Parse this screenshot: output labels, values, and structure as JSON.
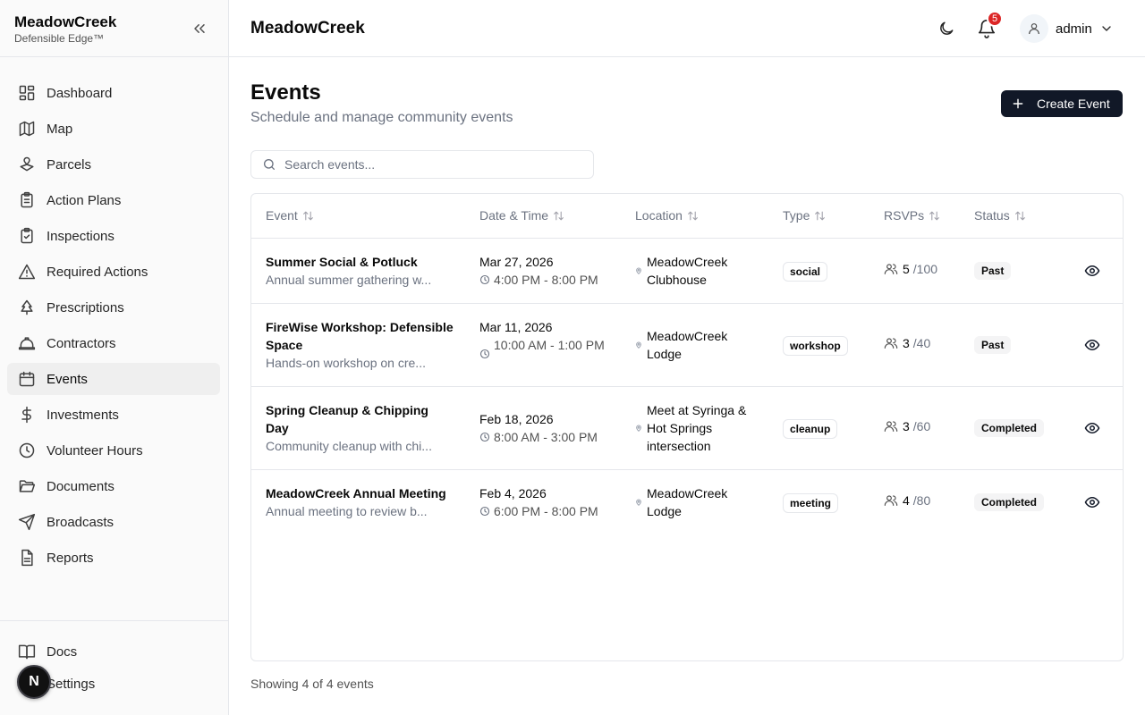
{
  "sidebar": {
    "brand": "MeadowCreek",
    "tagline": "Defensible Edge™",
    "items": [
      {
        "label": "Dashboard",
        "icon": "dashboard-icon"
      },
      {
        "label": "Map",
        "icon": "map-icon"
      },
      {
        "label": "Parcels",
        "icon": "parcels-icon"
      },
      {
        "label": "Action Plans",
        "icon": "clipboard-icon"
      },
      {
        "label": "Inspections",
        "icon": "clipboard-check-icon"
      },
      {
        "label": "Required Actions",
        "icon": "alert-triangle-icon"
      },
      {
        "label": "Prescriptions",
        "icon": "tree-icon"
      },
      {
        "label": "Contractors",
        "icon": "hard-hat-icon"
      },
      {
        "label": "Events",
        "icon": "calendar-icon",
        "active": true
      },
      {
        "label": "Investments",
        "icon": "dollar-icon"
      },
      {
        "label": "Volunteer Hours",
        "icon": "clock-icon"
      },
      {
        "label": "Documents",
        "icon": "folder-open-icon"
      },
      {
        "label": "Broadcasts",
        "icon": "send-icon"
      },
      {
        "label": "Reports",
        "icon": "file-text-icon"
      }
    ],
    "bottom_items": [
      {
        "label": "Docs",
        "icon": "book-icon"
      },
      {
        "label": "Settings",
        "icon": "gear-icon"
      }
    ],
    "floating_badge": "N"
  },
  "header": {
    "title": "MeadowCreek",
    "notification_count": "5",
    "user": "admin"
  },
  "main": {
    "title": "Events",
    "subtitle": "Schedule and manage community events",
    "create_label": "Create Event",
    "search_placeholder": "Search events...",
    "columns": [
      "Event",
      "Date & Time",
      "Location",
      "Type",
      "RSVPs",
      "Status"
    ],
    "events": [
      {
        "title": "Summer Social & Potluck",
        "description": "Annual summer gathering w...",
        "date": "Mar 27, 2026",
        "time": "4:00 PM - 8:00 PM",
        "location": "MeadowCreek Clubhouse",
        "type": "social",
        "rsvp_count": "5",
        "rsvp_capacity": "/100",
        "status": "Past"
      },
      {
        "title": "FireWise Workshop: Defensible Space",
        "description": "Hands-on workshop on cre...",
        "date": "Mar 11, 2026",
        "time": "10:00 AM - 1:00 PM",
        "location": "MeadowCreek Lodge",
        "type": "workshop",
        "rsvp_count": "3",
        "rsvp_capacity": "/40",
        "status": "Past"
      },
      {
        "title": "Spring Cleanup & Chipping Day",
        "description": "Community cleanup with chi...",
        "date": "Feb 18, 2026",
        "time": "8:00 AM - 3:00 PM",
        "location": "Meet at Syringa & Hot Springs intersection",
        "type": "cleanup",
        "rsvp_count": "3",
        "rsvp_capacity": "/60",
        "status": "Completed"
      },
      {
        "title": "MeadowCreek Annual Meeting",
        "description": "Annual meeting to review b...",
        "date": "Feb 4, 2026",
        "time": "6:00 PM - 8:00 PM",
        "location": "MeadowCreek Lodge",
        "type": "meeting",
        "rsvp_count": "4",
        "rsvp_capacity": "/80",
        "status": "Completed"
      }
    ],
    "footer": "Showing 4 of 4 events"
  }
}
